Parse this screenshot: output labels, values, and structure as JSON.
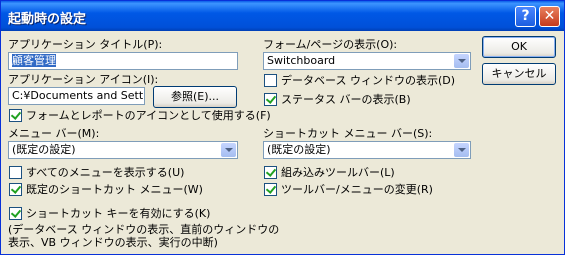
{
  "window": {
    "title": "起動時の設定",
    "help_glyph": "?",
    "close_glyph": "✕"
  },
  "app_title": {
    "label": "アプリケーション タイトル(P):",
    "value": "顧客管理"
  },
  "app_icon": {
    "label": "アプリケーション アイコン(I):",
    "value": "C:¥Documents and Settings",
    "browse": "参照(E)..."
  },
  "use_icon_check": {
    "label": "フォームとレポートのアイコンとして使用する(F)",
    "checked": true
  },
  "menu_bar": {
    "label": "メニュー バー(M):",
    "value": "(既定の設定)"
  },
  "show_all_menus": {
    "label": "すべてのメニューを表示する(U)",
    "checked": false
  },
  "default_shortcut_menu": {
    "label": "既定のショートカット メニュー(W)",
    "checked": true
  },
  "form_page": {
    "label": "フォーム/ページの表示(O):",
    "value": "Switchboard"
  },
  "show_db_window": {
    "label": "データベース ウィンドウの表示(D)",
    "checked": false
  },
  "show_status_bar": {
    "label": "ステータス バーの表示(B)",
    "checked": true
  },
  "shortcut_menu_bar": {
    "label": "ショートカット メニュー バー(S):",
    "value": "(既定の設定)"
  },
  "builtin_toolbars": {
    "label": "組み込みツールバー(L)",
    "checked": true
  },
  "toolbar_menu_changes": {
    "label": "ツールバー/メニューの変更(R)",
    "checked": true
  },
  "special_keys": {
    "label": "ショートカット キーを有効にする(K)",
    "checked": true,
    "note_line1": "(データベース ウィンドウの表示、直前のウィンドウの",
    "note_line2": "表示、VB ウィンドウの表示、実行の中断)"
  },
  "buttons": {
    "ok": "OK",
    "cancel": "キャンセル"
  }
}
